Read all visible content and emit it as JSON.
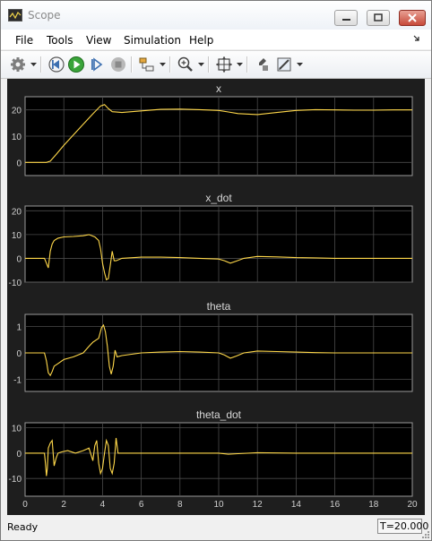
{
  "window": {
    "title": "Scope"
  },
  "menu": {
    "items": [
      "File",
      "Tools",
      "View",
      "Simulation",
      "Help"
    ]
  },
  "toolbar": {
    "icons": [
      "gear-icon",
      "step-back-icon",
      "run-icon",
      "step-forward-icon",
      "stop-icon",
      "signal-select-icon",
      "zoom-icon",
      "autoscale-icon",
      "style-icon",
      "measurement-icon"
    ]
  },
  "chart_data": [
    {
      "type": "line",
      "title": "x",
      "xlim": [
        0,
        20
      ],
      "ylim": [
        -5,
        25
      ],
      "yticks": [
        0,
        10,
        20
      ],
      "grid": true,
      "series": [
        {
          "color": "#ffd84a",
          "x": [
            0,
            1.1,
            1.3,
            1.6,
            2,
            2.5,
            3,
            3.5,
            3.9,
            4.1,
            4.3,
            4.5,
            5,
            6,
            7,
            8,
            9,
            10,
            10.5,
            11,
            12,
            13,
            14,
            15,
            16,
            17,
            18,
            19,
            20
          ],
          "y": [
            0,
            0,
            0.5,
            3,
            6.5,
            10.5,
            14.5,
            18.5,
            21.5,
            22,
            20.5,
            19.3,
            19,
            19.6,
            20.2,
            20.3,
            20.1,
            19.8,
            19.2,
            18.6,
            18.2,
            19,
            19.8,
            20.1,
            20,
            19.9,
            19.9,
            20,
            20
          ]
        }
      ]
    },
    {
      "type": "line",
      "title": "x_dot",
      "xlim": [
        0,
        20
      ],
      "ylim": [
        -10,
        22
      ],
      "yticks": [
        -10,
        0,
        10,
        20
      ],
      "grid": true,
      "series": [
        {
          "color": "#ffd84a",
          "x": [
            0,
            1,
            1.1,
            1.2,
            1.3,
            1.4,
            1.5,
            1.7,
            2,
            2.5,
            3,
            3.3,
            3.6,
            3.8,
            3.9,
            4,
            4.1,
            4.2,
            4.3,
            4.4,
            4.5,
            4.6,
            4.7,
            5,
            6,
            7,
            8,
            9,
            10,
            10.3,
            10.6,
            10.9,
            11.3,
            12,
            13,
            14,
            15,
            16,
            17,
            18,
            19,
            20
          ],
          "y": [
            0,
            0,
            -2,
            -4,
            3,
            6,
            7.5,
            8.5,
            9,
            9.2,
            9.5,
            10,
            9,
            7.5,
            4,
            -2,
            -6,
            -9,
            -8.5,
            -3,
            3,
            -1,
            -1,
            0,
            0.5,
            0.5,
            0.3,
            0,
            -0.3,
            -1,
            -2,
            -1.2,
            0,
            0.8,
            0.6,
            0.3,
            0.2,
            0,
            0,
            0,
            0,
            0
          ]
        }
      ]
    },
    {
      "type": "line",
      "title": "theta",
      "xlim": [
        0,
        20
      ],
      "ylim": [
        -1.45,
        1.45
      ],
      "yticks": [
        -1,
        0,
        1
      ],
      "grid": true,
      "series": [
        {
          "color": "#ffd84a",
          "x": [
            0,
            1,
            1.1,
            1.2,
            1.3,
            1.4,
            1.5,
            1.7,
            2,
            2.5,
            3,
            3.3,
            3.5,
            3.8,
            3.95,
            4.05,
            4.15,
            4.25,
            4.35,
            4.45,
            4.55,
            4.65,
            4.75,
            5,
            6,
            7,
            8,
            9,
            10,
            10.3,
            10.6,
            10.9,
            11.3,
            12,
            13,
            14,
            15,
            16,
            17,
            18,
            19,
            20
          ],
          "y": [
            0,
            0,
            -0.3,
            -0.75,
            -0.85,
            -0.7,
            -0.5,
            -0.4,
            -0.25,
            -0.15,
            0,
            0.25,
            0.4,
            0.55,
            0.95,
            1.05,
            0.8,
            0.25,
            -0.5,
            -0.8,
            -0.5,
            0.1,
            -0.15,
            -0.1,
            0,
            0.03,
            0.05,
            0.03,
            0,
            -0.08,
            -0.2,
            -0.12,
            0,
            0.07,
            0.05,
            0.03,
            0.01,
            0,
            0,
            0,
            0,
            0
          ]
        }
      ]
    },
    {
      "type": "line",
      "title": "theta_dot",
      "xlim": [
        0,
        20
      ],
      "ylim": [
        -17,
        12
      ],
      "yticks": [
        -10,
        0,
        10
      ],
      "grid": true,
      "xticks": [
        0,
        2,
        4,
        6,
        8,
        10,
        12,
        14,
        16,
        18,
        20
      ],
      "series": [
        {
          "color": "#ffd84a",
          "x": [
            0,
            1,
            1.05,
            1.1,
            1.15,
            1.2,
            1.3,
            1.4,
            1.5,
            1.6,
            1.7,
            1.9,
            2.2,
            2.6,
            3,
            3.3,
            3.5,
            3.6,
            3.7,
            3.8,
            3.9,
            4,
            4.1,
            4.2,
            4.3,
            4.4,
            4.5,
            4.6,
            4.7,
            4.8,
            5,
            6,
            7,
            8,
            9,
            10,
            10.5,
            11,
            12,
            14,
            16,
            20
          ],
          "y": [
            0,
            0,
            -4,
            -9,
            -6,
            2,
            4,
            5,
            -5,
            -2,
            0,
            0.5,
            1,
            0,
            1,
            2,
            -3,
            3,
            5,
            -4,
            -8,
            -6,
            0,
            5,
            3,
            -6,
            -8,
            -4,
            6,
            0,
            0,
            0,
            0,
            0,
            0,
            0,
            -0.4,
            -0.2,
            0.2,
            0,
            0,
            0
          ]
        }
      ]
    }
  ],
  "status": {
    "text": "Ready",
    "time": "T=20.000"
  }
}
